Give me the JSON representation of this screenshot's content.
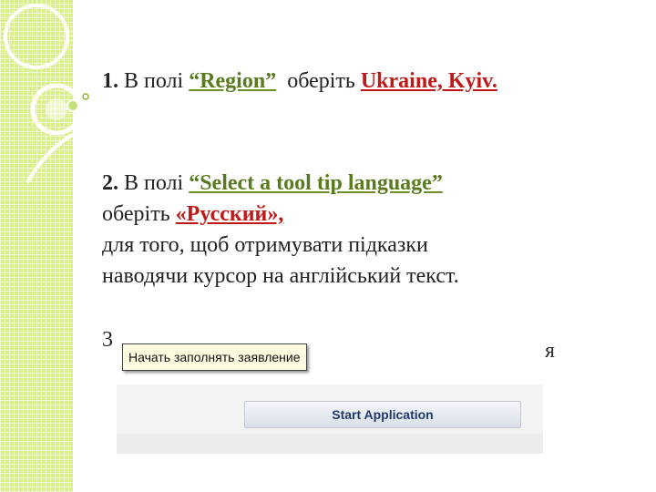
{
  "colors": {
    "accent_green": "#5a7a1f",
    "highlight_red": "#c01818",
    "strip_lime": "#d9ef8e",
    "tooltip_bg": "#fffbe0",
    "button_text": "#1f3a6b"
  },
  "step1": {
    "num": "1.",
    "pre": "В полі ",
    "field": "“Region”",
    "mid": "  оберіть ",
    "value": "Ukraine, Kyiv."
  },
  "step2": {
    "num": "2.",
    "pre": "В полі ",
    "field": "“Select a tool tip language”",
    "line2_pre": "оберіть ",
    "value": "«Русский»,",
    "line3": "для того, щоб отримувати підказки",
    "line4": "наводячи курсор на англійський текст."
  },
  "step3": {
    "visible_fragment": "3",
    "tail": "я"
  },
  "inset": {
    "tooltip": "Начать заполнять заявление",
    "button": "Start Application"
  }
}
